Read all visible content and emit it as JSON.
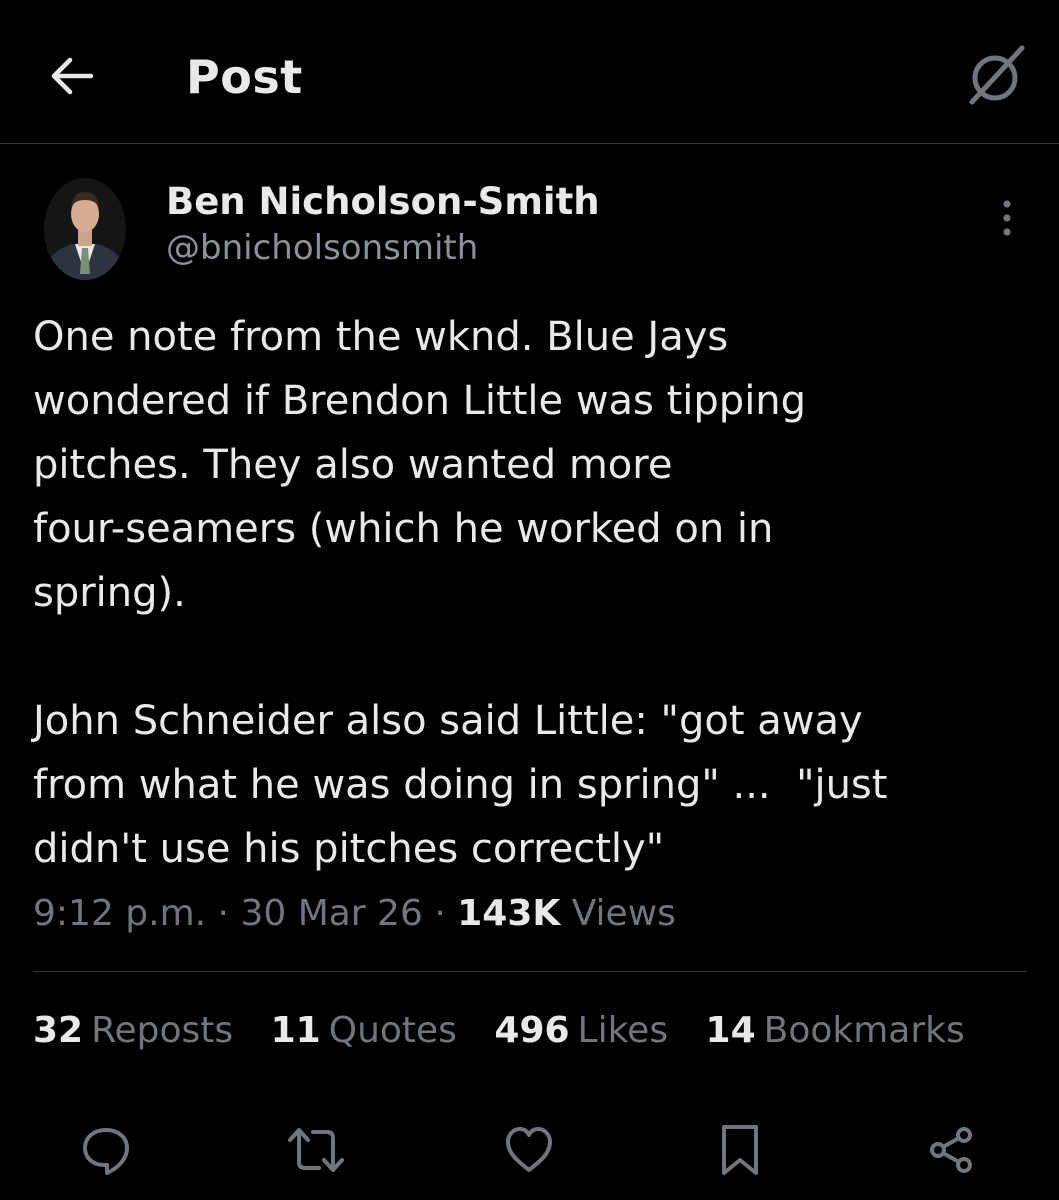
{
  "header": {
    "title": "Post",
    "back_icon": "arrow-left-icon",
    "grok_icon": "grok-icon"
  },
  "post": {
    "author_name": "Ben Nicholson-Smith",
    "author_handle": "@bnicholsonsmith",
    "more_icon": "more-vertical-icon",
    "text": "One note from the wknd. Blue Jays\nwondered if Brendon Little was tipping\npitches. They also wanted more\nfour-seamers (which he worked on in\nspring).\n\nJohn Schneider also said Little: \"got away\nfrom what he was doing in spring\" ...  \"just\ndidn't use his pitches correctly\"",
    "time": "9:12 p.m.",
    "sep1": " · ",
    "date": "30 Mar 26",
    "sep2": " · ",
    "views_count": "143K",
    "views_label": "Views"
  },
  "stats": {
    "reposts": {
      "count": "32",
      "label": "Reposts"
    },
    "quotes": {
      "count": "11",
      "label": "Quotes"
    },
    "likes": {
      "count": "496",
      "label": "Likes"
    },
    "bookmarks": {
      "count": "14",
      "label": "Bookmarks"
    }
  },
  "actions": [
    "reply-icon",
    "repost-icon",
    "like-icon",
    "bookmark-icon",
    "share-icon"
  ],
  "colors": {
    "background": "#000000",
    "primary_text": "#e7e9ea",
    "secondary_text": "#71767b",
    "divider": "#2f3336"
  }
}
